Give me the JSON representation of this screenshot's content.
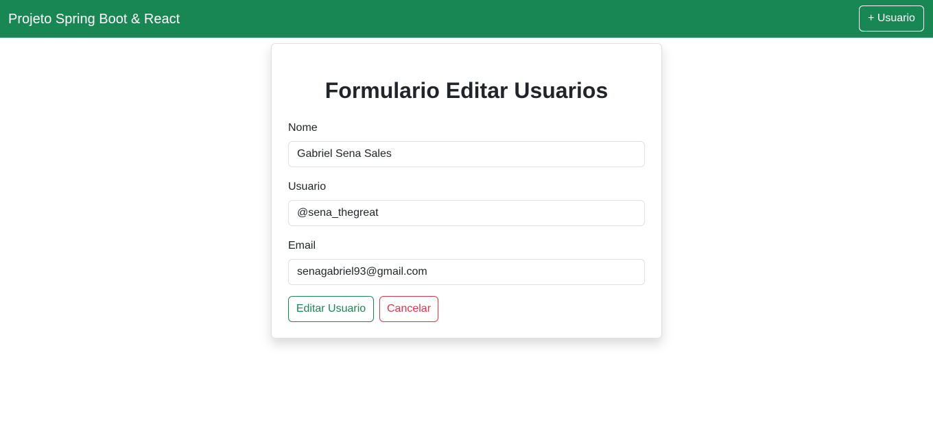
{
  "navbar": {
    "brand": "Projeto Spring Boot & React",
    "add_user_label": "+ Usuario",
    "background_color": "#198754"
  },
  "form": {
    "title": "Formulario Editar Usuarios",
    "fields": {
      "nome": {
        "label": "Nome",
        "value": "Gabriel Sena Sales"
      },
      "usuario": {
        "label": "Usuario",
        "value": "@sena_thegreat"
      },
      "email": {
        "label": "Email",
        "value": "senagabriel93@gmail.com"
      }
    },
    "submit_label": "Editar Usuario",
    "cancel_label": "Cancelar",
    "submit_color": "#198754",
    "cancel_color": "#dc3545"
  }
}
